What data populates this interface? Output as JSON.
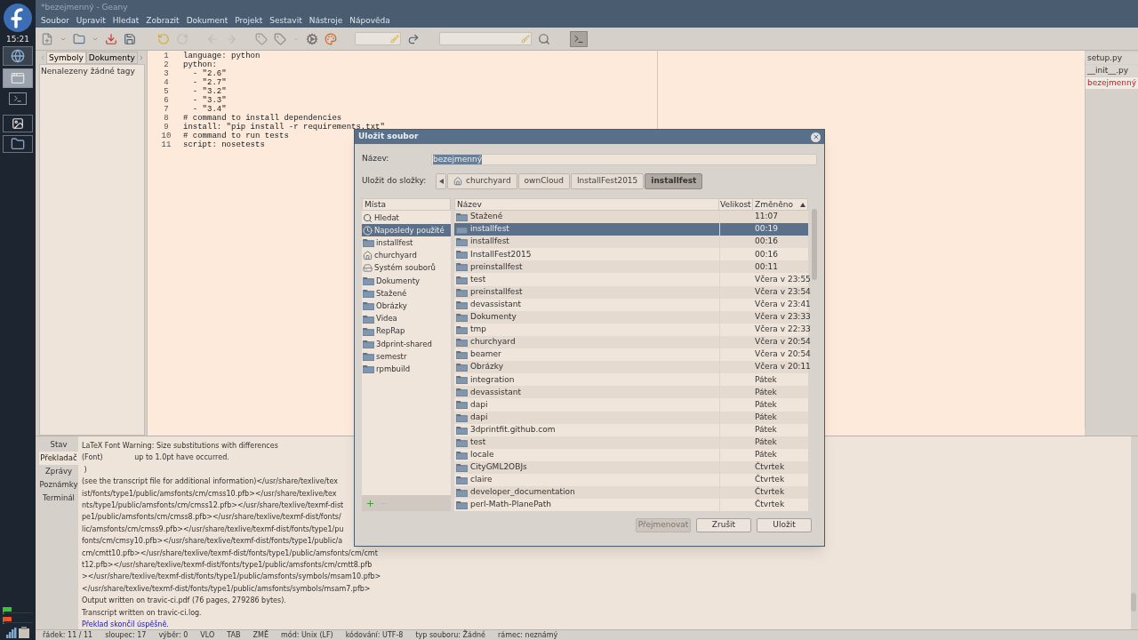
{
  "dock": {
    "clock": "15:21"
  },
  "window": {
    "title": "*bezejmenný - Geany"
  },
  "menu": [
    "Soubor",
    "Upravit",
    "Hledat",
    "Zobrazit",
    "Dokument",
    "Projekt",
    "Sestavit",
    "Nástroje",
    "Nápověda"
  ],
  "sidebar": {
    "tabs": [
      {
        "label": "Symboly",
        "selected": true
      },
      {
        "label": "Dokumenty",
        "selected": false
      }
    ],
    "message": "Nenalezeny žádné tagy"
  },
  "editor": {
    "lines": [
      {
        "number": "1",
        "text": "language: python"
      },
      {
        "number": "2",
        "text": "python:"
      },
      {
        "number": "3",
        "text": "  - \"2.6\""
      },
      {
        "number": "4",
        "text": "  - \"2.7\""
      },
      {
        "number": "5",
        "text": "  - \"3.2\""
      },
      {
        "number": "6",
        "text": "  - \"3.3\""
      },
      {
        "number": "7",
        "text": "  - \"3.4\""
      },
      {
        "number": "8",
        "text": "# command to install dependencies"
      },
      {
        "number": "9",
        "text": "install: \"pip install -r requirements.txt\""
      },
      {
        "number": "10",
        "text": "# command to run tests"
      },
      {
        "number": "11",
        "text": "script: nosetests"
      }
    ]
  },
  "open_files": [
    {
      "label": "setup.py",
      "selected": false,
      "modified": false
    },
    {
      "label": "__init__.py",
      "selected": false,
      "modified": false
    },
    {
      "label": "bezejmenný",
      "selected": true,
      "modified": true
    }
  ],
  "messages": {
    "tabs": [
      {
        "label": "Stav",
        "selected": false
      },
      {
        "label": "Překladač",
        "selected": true
      },
      {
        "label": "Zprávy",
        "selected": false
      },
      {
        "label": "Poznámky",
        "selected": false
      },
      {
        "label": "Terminál",
        "selected": false
      }
    ],
    "lines": [
      {
        "kind": "plain",
        "text": "LaTeX Font Warning: Size substitutions with differences"
      },
      {
        "kind": "plain",
        "text": "(Font)              up to 1.0pt have occurred."
      },
      {
        "kind": "plain",
        "text": " )"
      },
      {
        "kind": "plain",
        "text": "(see the transcript file for additional information)</usr/share/texlive/tex"
      },
      {
        "kind": "plain",
        "text": "ist/fonts/type1/public/amsfonts/cm/cmss10.pfb></usr/share/texlive/tex"
      },
      {
        "kind": "plain",
        "text": "nts/type1/public/amsfonts/cm/cmss12.pfb></usr/share/texlive/texmf-dist"
      },
      {
        "kind": "plain",
        "text": "pe1/public/amsfonts/cm/cmss8.pfb></usr/share/texlive/texmf-dist/fonts/"
      },
      {
        "kind": "plain",
        "text": "lic/amsfonts/cm/cmss9.pfb></usr/share/texlive/texmf-dist/fonts/type1/pu"
      },
      {
        "kind": "plain",
        "text": "fonts/cm/cmsy10.pfb></usr/share/texlive/texmf-dist/fonts/type1/public/a"
      },
      {
        "kind": "plain",
        "text": "cm/cmtt10.pfb></usr/share/texlive/texmf-dist/fonts/type1/public/amsfonts/cm/cmt"
      },
      {
        "kind": "plain",
        "text": "t12.pfb></usr/share/texlive/texmf-dist/fonts/type1/public/amsfonts/cm/cmtt8.pfb"
      },
      {
        "kind": "plain",
        "text": "></usr/share/texlive/texmf-dist/fonts/type1/public/amsfonts/symbols/msam10.pfb>"
      },
      {
        "kind": "plain",
        "text": "</usr/share/texlive/texmf-dist/fonts/type1/public/amsfonts/symbols/msam7.pfb>"
      },
      {
        "kind": "plain",
        "text": "Output written on travic-ci.pdf (76 pages, 279286 bytes)."
      },
      {
        "kind": "plain",
        "text": "Transcript written on travic-ci.log."
      },
      {
        "kind": "success",
        "text": "Překlad skončil úspěšně."
      }
    ]
  },
  "status_bar": [
    "řádek: 11 / 11",
    "sloupec: 17",
    "výběr: 0",
    "VLO",
    "TAB",
    "ZMĚ",
    "mód: Unix (LF)",
    "kódování: UTF-8",
    "typ souboru: Žádné",
    "rámec: neznámý"
  ],
  "dialog": {
    "title": "Uložit soubor",
    "name_label": "Název:",
    "name_value": "bezejmenný",
    "folder_label": "Uložit do složky:",
    "path": [
      {
        "label": "churchyard",
        "selected": false,
        "kind": "home"
      },
      {
        "label": "ownCloud",
        "selected": false,
        "kind": "plain"
      },
      {
        "label": "InstallFest2015",
        "selected": false,
        "kind": "plain"
      },
      {
        "label": "installfest",
        "selected": true,
        "kind": "plain"
      }
    ],
    "places_header": "Místa",
    "places": [
      {
        "label": "Hledat",
        "kind": "search",
        "selected": false
      },
      {
        "label": "Naposledy použité",
        "kind": "recent",
        "selected": true
      },
      {
        "label": "installfest",
        "kind": "folder",
        "selected": false
      },
      {
        "label": "churchyard",
        "kind": "home",
        "selected": false
      },
      {
        "label": "Systém souborů",
        "kind": "drive",
        "selected": false
      },
      {
        "label": "Dokumenty",
        "kind": "folder",
        "selected": false
      },
      {
        "label": "Stažené",
        "kind": "folder",
        "selected": false
      },
      {
        "label": "Obrázky",
        "kind": "folder",
        "selected": false
      },
      {
        "label": "Videa",
        "kind": "folder",
        "selected": false
      },
      {
        "label": "RepRap",
        "kind": "folder",
        "selected": false
      },
      {
        "label": "3dprint-shared",
        "kind": "folder",
        "selected": false
      },
      {
        "label": "semestr",
        "kind": "folder",
        "selected": false
      },
      {
        "label": "rpmbuild",
        "kind": "folder",
        "selected": false
      }
    ],
    "columns": [
      "Název",
      "Velikost",
      "Změněno"
    ],
    "rows": [
      {
        "name": "Stažené",
        "modified": "11:07",
        "selected": false
      },
      {
        "name": "installfest",
        "modified": "00:19",
        "selected": true
      },
      {
        "name": "installfest",
        "modified": "00:16",
        "selected": false
      },
      {
        "name": "InstallFest2015",
        "modified": "00:16",
        "selected": false
      },
      {
        "name": "preinstallfest",
        "modified": "00:11",
        "selected": false
      },
      {
        "name": "test",
        "modified": "Včera v 23:55",
        "selected": false
      },
      {
        "name": "preinstallfest",
        "modified": "Včera v 23:54",
        "selected": false
      },
      {
        "name": "devassistant",
        "modified": "Včera v 23:41",
        "selected": false
      },
      {
        "name": "Dokumenty",
        "modified": "Včera v 23:33",
        "selected": false
      },
      {
        "name": "tmp",
        "modified": "Včera v 22:33",
        "selected": false
      },
      {
        "name": "churchyard",
        "modified": "Včera v 20:54",
        "selected": false
      },
      {
        "name": "beamer",
        "modified": "Včera v 20:54",
        "selected": false
      },
      {
        "name": "Obrázky",
        "modified": "Včera v 20:11",
        "selected": false
      },
      {
        "name": "integration",
        "modified": "Pátek",
        "selected": false
      },
      {
        "name": "devassistant",
        "modified": "Pátek",
        "selected": false
      },
      {
        "name": "dapi",
        "modified": "Pátek",
        "selected": false
      },
      {
        "name": "dapi",
        "modified": "Pátek",
        "selected": false
      },
      {
        "name": "3dprintfit.github.com",
        "modified": "Pátek",
        "selected": false
      },
      {
        "name": "test",
        "modified": "Pátek",
        "selected": false
      },
      {
        "name": "locale",
        "modified": "Pátek",
        "selected": false
      },
      {
        "name": "CityGML2OBJs",
        "modified": "Čtvrtek",
        "selected": false
      },
      {
        "name": "claire",
        "modified": "Čtvrtek",
        "selected": false
      },
      {
        "name": "developer_documentation",
        "modified": "Čtvrtek",
        "selected": false
      },
      {
        "name": "perl-Math-PlanePath",
        "modified": "Čtvrtek",
        "selected": false
      }
    ],
    "buttons": [
      {
        "label": "Přejmenovat",
        "disabled": true
      },
      {
        "label": "Zrušit",
        "disabled": false
      },
      {
        "label": "Uložit",
        "disabled": false
      }
    ]
  }
}
